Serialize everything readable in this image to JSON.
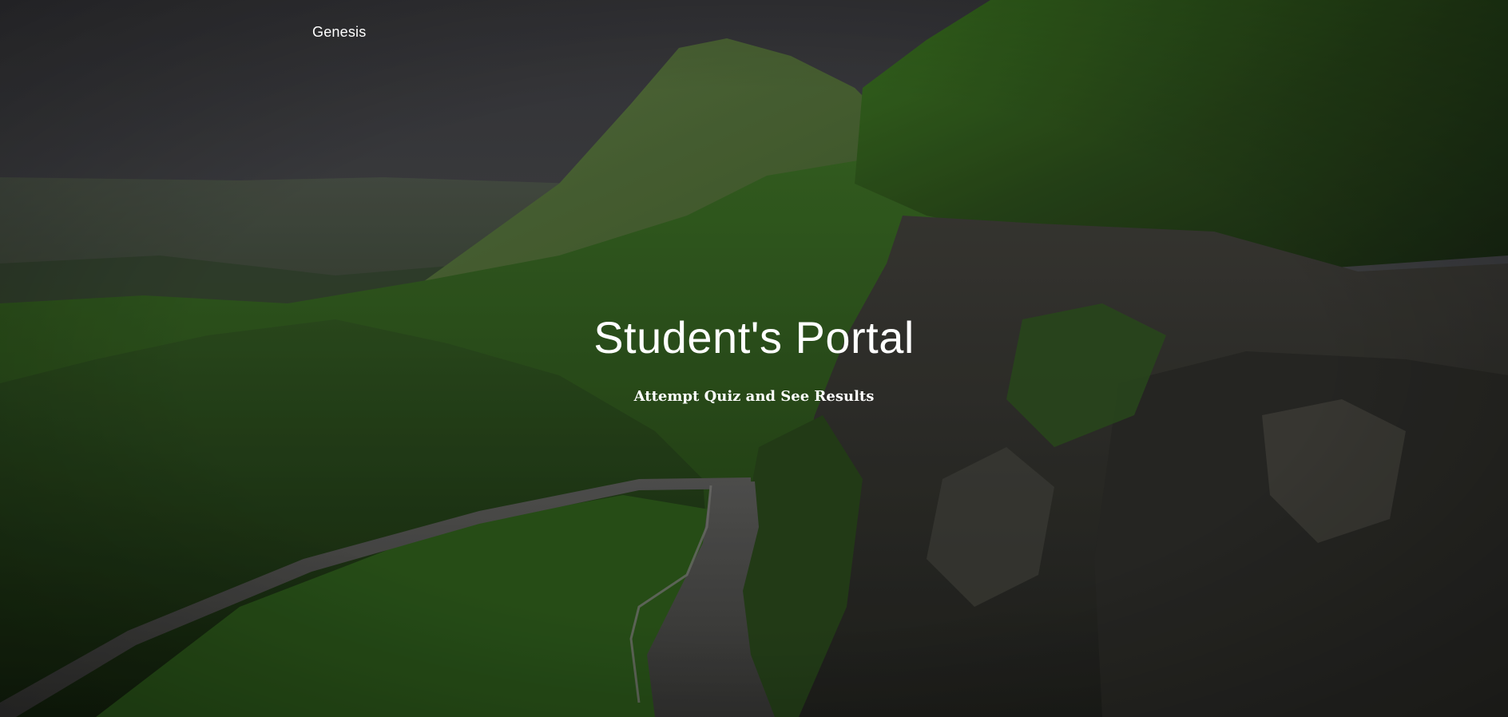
{
  "navbar": {
    "brand": "Genesis"
  },
  "hero": {
    "title": "Student's Portal",
    "subtitle": "Attempt Quiz and See Results"
  }
}
